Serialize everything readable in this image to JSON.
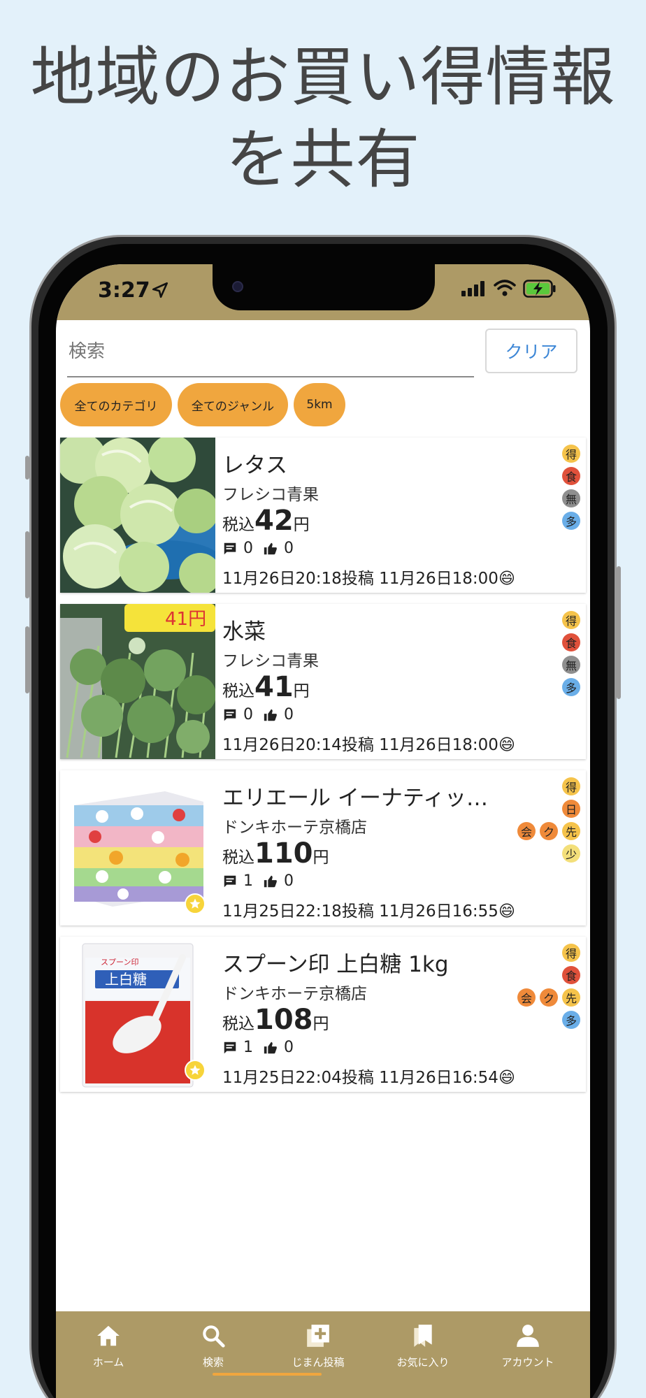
{
  "headline": {
    "line1": "地域のお買い得情報",
    "line2": "を共有"
  },
  "status": {
    "time": "3:27"
  },
  "search": {
    "placeholder": "検索",
    "clear_label": "クリア"
  },
  "filters": [
    "全てのカテゴリ",
    "全てのジャンル",
    "5km"
  ],
  "items": [
    {
      "title": "レタス",
      "store": "フレシコ青果",
      "tax_label": "税込",
      "price": "42",
      "yen": "円",
      "comments": "0",
      "likes": "0",
      "dates": "11月26日20:18投稿 11月26日18:00😄",
      "badges": [
        "得",
        "食",
        "無",
        "多"
      ],
      "starred": false,
      "photo": "lettuce"
    },
    {
      "title": "水菜",
      "store": "フレシコ青果",
      "tax_label": "税込",
      "price": "41",
      "yen": "円",
      "comments": "0",
      "likes": "0",
      "dates": "11月26日20:14投稿 11月26日18:00😄",
      "badges": [
        "得",
        "食",
        "無",
        "多"
      ],
      "starred": false,
      "photo": "mizuna"
    },
    {
      "title": "エリエール イーナティッ…",
      "store": "ドンキホーテ京橋店",
      "tax_label": "税込",
      "price": "110",
      "yen": "円",
      "comments": "1",
      "likes": "0",
      "dates": "11月25日22:18投稿 11月26日16:55😄",
      "badges": [
        "得",
        "日",
        "会",
        "ク",
        "先",
        "少"
      ],
      "starred": true,
      "photo": "tissue"
    },
    {
      "title": "スプーン印 上白糖 1kg",
      "store": "ドンキホーテ京橋店",
      "tax_label": "税込",
      "price": "108",
      "yen": "円",
      "comments": "1",
      "likes": "0",
      "dates": "11月25日22:04投稿 11月26日16:54😄",
      "badges": [
        "得",
        "食",
        "会",
        "ク",
        "先",
        "多"
      ],
      "starred": true,
      "photo": "sugar"
    }
  ],
  "tabs": [
    {
      "label": "ホーム",
      "icon": "home-icon"
    },
    {
      "label": "検索",
      "icon": "search-icon",
      "active": true
    },
    {
      "label": "じまん投稿",
      "icon": "add-post-icon"
    },
    {
      "label": "お気に入り",
      "icon": "bookmark-icon"
    },
    {
      "label": "アカウント",
      "icon": "account-icon"
    }
  ],
  "colors": {
    "background": "#e3f1fa",
    "statusbar": "#ad9a66",
    "chip": "#f0a63e",
    "accent_blue": "#3c86d6",
    "badge_toku": "#f5c34b",
    "badge_shoku": "#e0513b",
    "badge_mu": "#8f8f8f",
    "badge_ta": "#6aaee8",
    "badge_kai": "#ef8a3a",
    "badge_saki": "#f5c34b",
    "badge_sho": "#f3df7a"
  }
}
